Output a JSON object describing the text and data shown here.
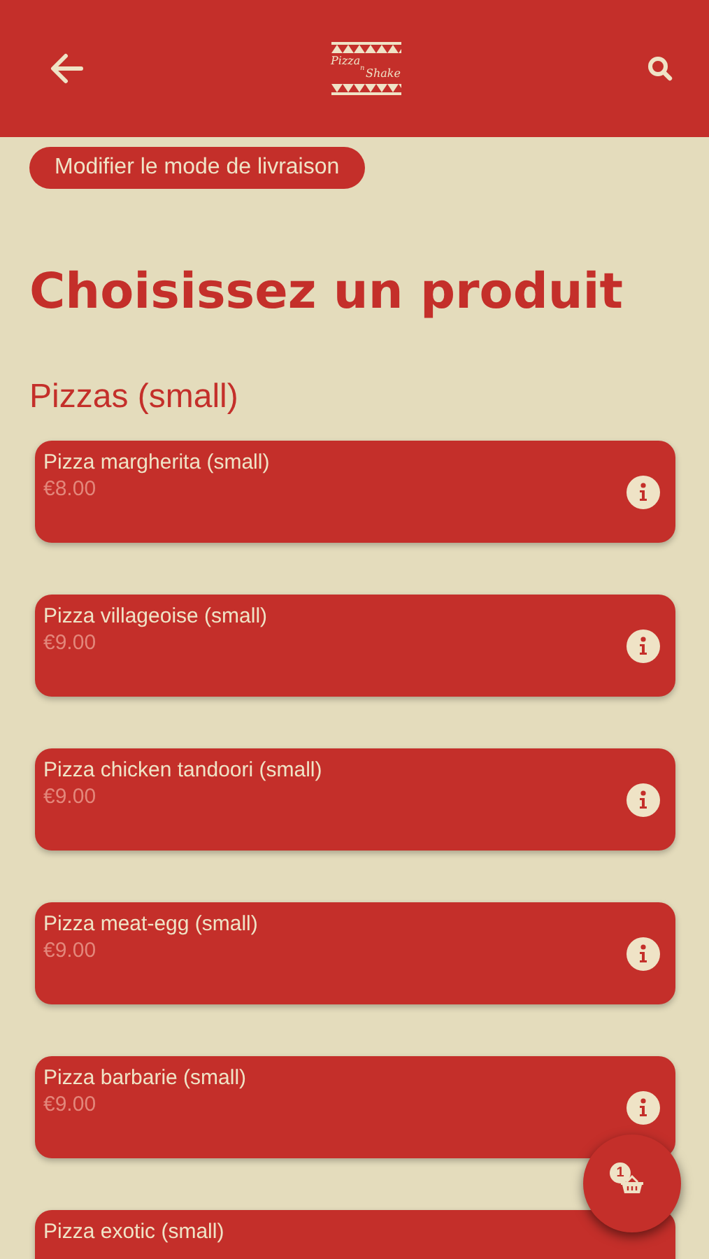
{
  "header": {
    "logo": {
      "line_1": "Pizza",
      "joiner": "n",
      "line_2": "Shake"
    }
  },
  "delivery_button": "Modifier le mode de livraison",
  "title": "Choisissez un produit",
  "section": "Pizzas (small)",
  "products": [
    {
      "name": "Pizza margherita (small)",
      "price": "€8.00"
    },
    {
      "name": "Pizza villageoise (small)",
      "price": "€9.00"
    },
    {
      "name": "Pizza chicken tandoori (small)",
      "price": "€9.00"
    },
    {
      "name": "Pizza meat-egg (small)",
      "price": "€9.00"
    },
    {
      "name": "Pizza barbarie (small)",
      "price": "€9.00"
    },
    {
      "name": "Pizza exotic (small)"
    }
  ],
  "cart": {
    "count": "1"
  }
}
